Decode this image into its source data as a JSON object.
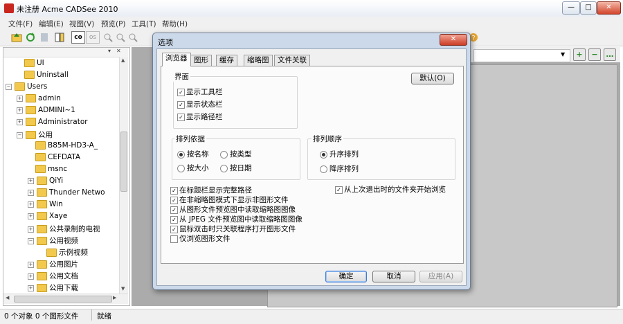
{
  "window": {
    "title": "未注册 Acme CADSee 2010",
    "controls": {
      "minimize": "—",
      "maximize": "□",
      "close": "✕"
    }
  },
  "menu": [
    "文件(F)",
    "编辑(E)",
    "视图(V)",
    "预览(P)",
    "工具(T)",
    "帮助(H)"
  ],
  "toolbar": {
    "co_label": "co",
    "os_label": "os"
  },
  "tree": {
    "items": [
      {
        "label": "UI",
        "depth": 2,
        "expander": ""
      },
      {
        "label": "Uninstall",
        "depth": 2,
        "expander": ""
      },
      {
        "label": "Users",
        "depth": 1,
        "expander": "−"
      },
      {
        "label": "admin",
        "depth": 2,
        "expander": "+"
      },
      {
        "label": "ADMINI~1",
        "depth": 2,
        "expander": "+"
      },
      {
        "label": "Administrator",
        "depth": 2,
        "expander": "+"
      },
      {
        "label": "公用",
        "depth": 2,
        "expander": "−"
      },
      {
        "label": "B85M-HD3-A_",
        "depth": 3,
        "expander": ""
      },
      {
        "label": "CEFDATA",
        "depth": 3,
        "expander": ""
      },
      {
        "label": "msnc",
        "depth": 3,
        "expander": ""
      },
      {
        "label": "QiYi",
        "depth": 3,
        "expander": "+"
      },
      {
        "label": "Thunder Netwo",
        "depth": 3,
        "expander": "+"
      },
      {
        "label": "Win",
        "depth": 3,
        "expander": "+"
      },
      {
        "label": "Xaye",
        "depth": 3,
        "expander": "+"
      },
      {
        "label": "公共录制的电视",
        "depth": 3,
        "expander": "+"
      },
      {
        "label": "公用视频",
        "depth": 3,
        "expander": "−"
      },
      {
        "label": "示例视频",
        "depth": 4,
        "expander": ""
      },
      {
        "label": "公用图片",
        "depth": 3,
        "expander": "+"
      },
      {
        "label": "公用文档",
        "depth": 3,
        "expander": "+"
      },
      {
        "label": "公用下载",
        "depth": 3,
        "expander": "+"
      }
    ]
  },
  "right": {
    "add_btn": "+",
    "remove_btn": "−",
    "more_btn": "…"
  },
  "status": {
    "left": "0 个对象 0 个图形文件",
    "right": "就绪"
  },
  "dialog": {
    "title": "选项",
    "close": "✕",
    "tabs": [
      "浏览器",
      "图形",
      "缓存",
      "缩略图",
      "文件关联"
    ],
    "active_tab": 0,
    "default_btn": "默认(O)",
    "interface": {
      "label": "界面",
      "items": [
        {
          "label": "显示工具栏",
          "checked": true
        },
        {
          "label": "显示状态栏",
          "checked": true
        },
        {
          "label": "显示路径栏",
          "checked": true
        }
      ]
    },
    "sort_by": {
      "label": "排列依据",
      "options": [
        {
          "label": "按名称",
          "selected": true
        },
        {
          "label": "按类型",
          "selected": false
        },
        {
          "label": "按大小",
          "selected": false
        },
        {
          "label": "按日期",
          "selected": false
        }
      ]
    },
    "sort_order": {
      "label": "排列顺序",
      "options": [
        {
          "label": "升序排列",
          "selected": true
        },
        {
          "label": "降序排列",
          "selected": false
        }
      ]
    },
    "restart_option": {
      "label": "从上次退出时的文件夹开始浏览",
      "checked": true
    },
    "options": [
      {
        "label": "在标题栏显示完整路径",
        "checked": true
      },
      {
        "label": "在非缩略图模式下显示非图形文件",
        "checked": true
      },
      {
        "label": "从图形文件预览图中读取缩略图图像",
        "checked": true
      },
      {
        "label": "从 JPEG 文件预览图中读取缩略图图像",
        "checked": true
      },
      {
        "label": "鼠标双击时只关联程序打开图形文件",
        "checked": true
      },
      {
        "label": "仅浏览图形文件",
        "checked": false
      }
    ],
    "buttons": {
      "ok": "确定",
      "cancel": "取消",
      "apply": "应用(A)"
    }
  }
}
